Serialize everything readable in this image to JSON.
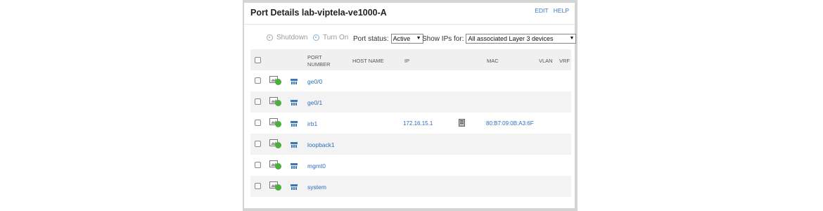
{
  "panel": {
    "title": "Port Details lab-viptela-ve1000-A",
    "edit_label": "EDIT",
    "help_label": "HELP"
  },
  "toolbar": {
    "shutdown_label": "Shutdown",
    "turn_on_label": "Turn On",
    "port_status_label": "Port status:",
    "port_status_value": "Active",
    "show_ips_label": "Show IPs for:",
    "show_ips_value": "All associated Layer 3 devices"
  },
  "table": {
    "headers": {
      "port_number_line1": "PORT",
      "port_number_line2": "NUMBER",
      "host_name": "HOST NAME",
      "ip": "IP",
      "mac": "MAC",
      "vlan": "VLAN",
      "vrf": "VRF"
    },
    "rows": [
      {
        "port": "ge0/0",
        "ip": "",
        "mac": "",
        "status": "up"
      },
      {
        "port": "ge0/1",
        "ip": "",
        "mac": "",
        "status": "up"
      },
      {
        "port": "irb1",
        "ip": "172.16.15.1",
        "mac": "80:B7:09:0B:A3:6F",
        "status": "up"
      },
      {
        "port": "loopback1",
        "ip": "",
        "mac": "",
        "status": "up"
      },
      {
        "port": "mgmt0",
        "ip": "",
        "mac": "",
        "status": "up"
      },
      {
        "port": "system",
        "ip": "",
        "mac": "",
        "status": "up"
      }
    ]
  },
  "colors": {
    "link": "#2a6ebb",
    "status_up": "#4cae3c"
  }
}
